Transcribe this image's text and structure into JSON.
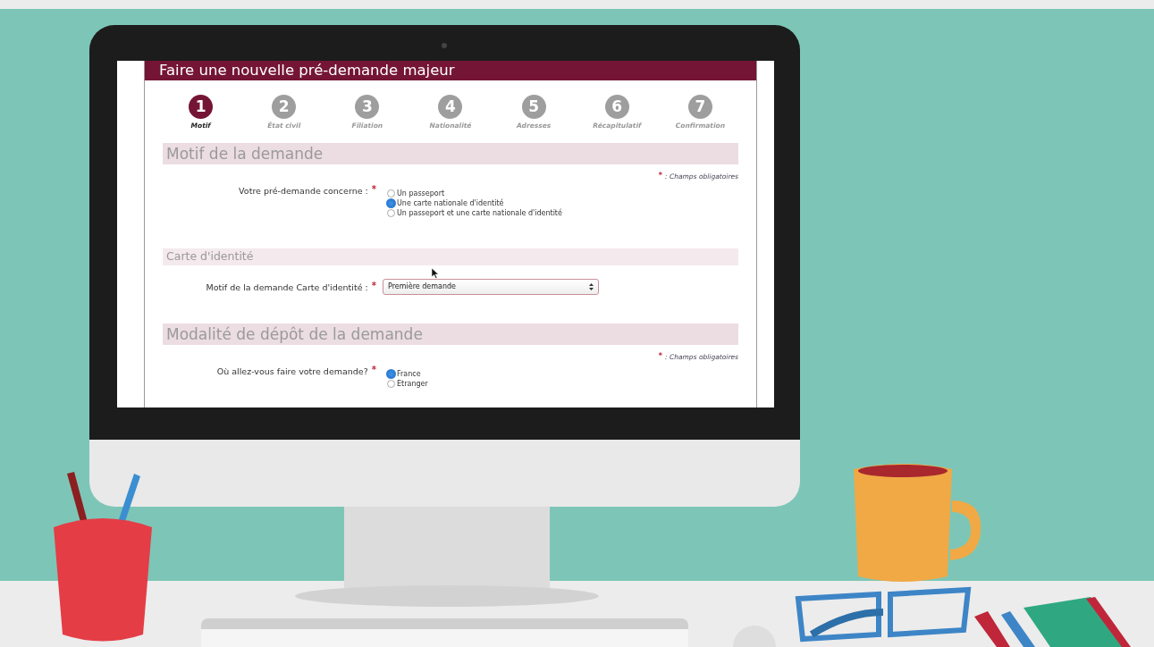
{
  "title": "Faire une nouvelle pré-demande majeur",
  "steps": [
    {
      "number": "1",
      "label": "Motif",
      "selected": true
    },
    {
      "number": "2",
      "label": "État civil",
      "selected": false
    },
    {
      "number": "3",
      "label": "Filiation",
      "selected": false
    },
    {
      "number": "4",
      "label": "Nationalité",
      "selected": false
    },
    {
      "number": "5",
      "label": "Adresses",
      "selected": false
    },
    {
      "number": "6",
      "label": "Récapitulatif",
      "selected": false
    },
    {
      "number": "7",
      "label": "Confirmation",
      "selected": false
    }
  ],
  "sections": [
    {
      "kind": "section",
      "title": "Motif de la demande",
      "note": {
        "mark": "*",
        "text": ": Champs obligatoires"
      },
      "fields": [
        {
          "kind": "radio",
          "label": "Votre pré-demande concerne :",
          "mark": "*",
          "options": [
            {
              "label": "Un passeport",
              "selected": false
            },
            {
              "label": "Une carte nationale d'identité",
              "selected": true
            },
            {
              "label": "Un passeport et une carte nationale d'identité",
              "selected": false
            }
          ]
        }
      ]
    },
    {
      "kind": "subsection",
      "title": "Carte d'identité",
      "fields": [
        {
          "kind": "select",
          "label": "Motif de la demande Carte d'identité :",
          "mark": "*",
          "value": "Première demande"
        }
      ]
    },
    {
      "kind": "section",
      "title": "Modalité de dépôt de la demande",
      "note": {
        "mark": "*",
        "text": ": Champs obligatoires"
      },
      "fields": [
        {
          "kind": "radio",
          "label": "Où allez-vous faire votre demande?",
          "mark": "*",
          "options": [
            {
              "label": "France",
              "selected": true
            },
            {
              "label": "Etranger",
              "selected": false
            }
          ]
        }
      ]
    }
  ]
}
